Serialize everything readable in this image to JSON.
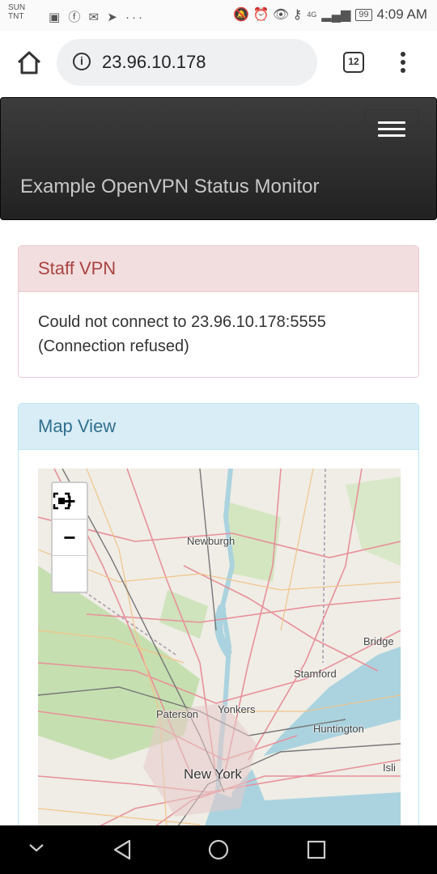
{
  "status_bar": {
    "carrier_line1": "SUN",
    "carrier_line2": "TNT",
    "left_icons": "▣ ⓕ ✉ ➤ ···",
    "right_icons": "🔕 ⏰ 👁 ⚷ ",
    "signal": "4G",
    "battery": "99",
    "time": "4:09 AM"
  },
  "browser": {
    "url": "23.96.10.178",
    "tab_count": "12"
  },
  "navbar": {
    "brand": "Example OpenVPN Status Monitor"
  },
  "staff_panel": {
    "title": "Staff VPN",
    "message_line1": "Could not connect to 23.96.10.178:5555",
    "message_line2": "(Connection refused)"
  },
  "map_panel": {
    "title": "Map View",
    "zoom_in": "+",
    "zoom_out": "−",
    "fullscreen": "⛶",
    "labels": {
      "newburgh": "Newburgh",
      "bridgeport": "Bridge",
      "stamford": "Stamford",
      "paterson": "Paterson",
      "yonkers": "Yonkers",
      "huntington": "Huntington",
      "new_york": "New York",
      "islip": "Isli"
    }
  },
  "colors": {
    "navbar_bg": "#222222",
    "danger_heading": "#a94442",
    "info_heading": "#31708f",
    "water": "#aad3df"
  }
}
